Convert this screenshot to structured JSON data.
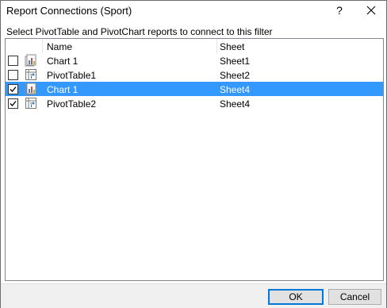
{
  "window": {
    "title": "Report Connections (Sport)",
    "help_label": "?"
  },
  "instruction": "Select PivotTable and PivotChart reports to connect to this filter",
  "columns": {
    "name": "Name",
    "sheet": "Sheet"
  },
  "rows": [
    {
      "checked": false,
      "icon": "pivotchart-icon",
      "name": "Chart 1",
      "sheet": "Sheet1",
      "selected": false
    },
    {
      "checked": false,
      "icon": "pivottable-icon",
      "name": "PivotTable1",
      "sheet": "Sheet2",
      "selected": false
    },
    {
      "checked": true,
      "icon": "pivotchart-icon",
      "name": "Chart 1",
      "sheet": "Sheet4",
      "selected": true
    },
    {
      "checked": true,
      "icon": "pivottable-icon",
      "name": "PivotTable2",
      "sheet": "Sheet4",
      "selected": false
    }
  ],
  "buttons": {
    "ok": "OK",
    "cancel": "Cancel"
  },
  "colors": {
    "selection": "#3399ff",
    "accent": "#0078d7"
  }
}
